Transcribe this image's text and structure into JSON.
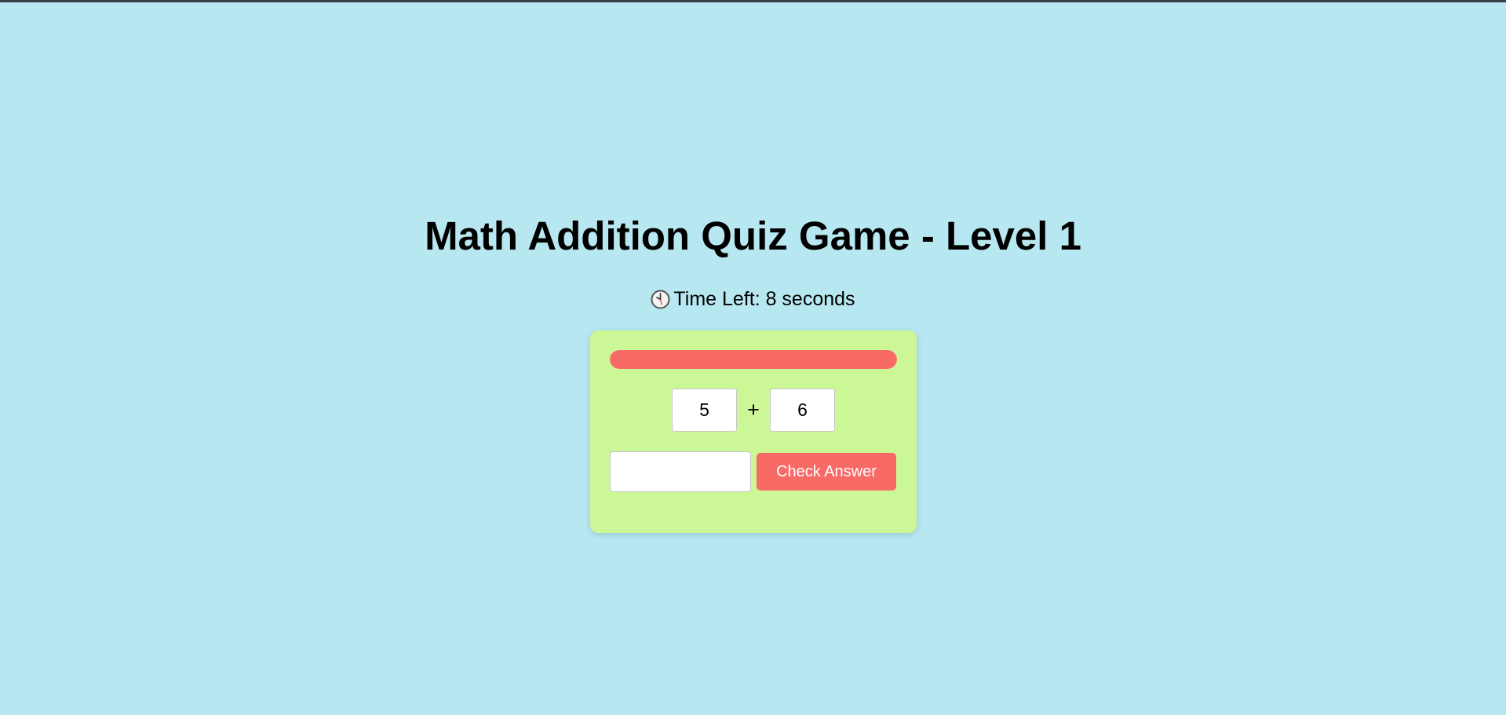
{
  "game": {
    "title": "Math Addition Quiz Game - Level 1",
    "timer_icon": "clock-icon",
    "timer_text": "Time Left: 8 seconds"
  },
  "quiz": {
    "progress_percent": 100,
    "progress_color": "#f86a66",
    "operand_a": "5",
    "operator": "+",
    "operand_b": "6",
    "answer_value": "",
    "answer_placeholder": "",
    "check_button_label": "Check Answer"
  },
  "colors": {
    "background": "#b7e7f0",
    "card": "#ccf797",
    "accent": "#f86a66"
  }
}
